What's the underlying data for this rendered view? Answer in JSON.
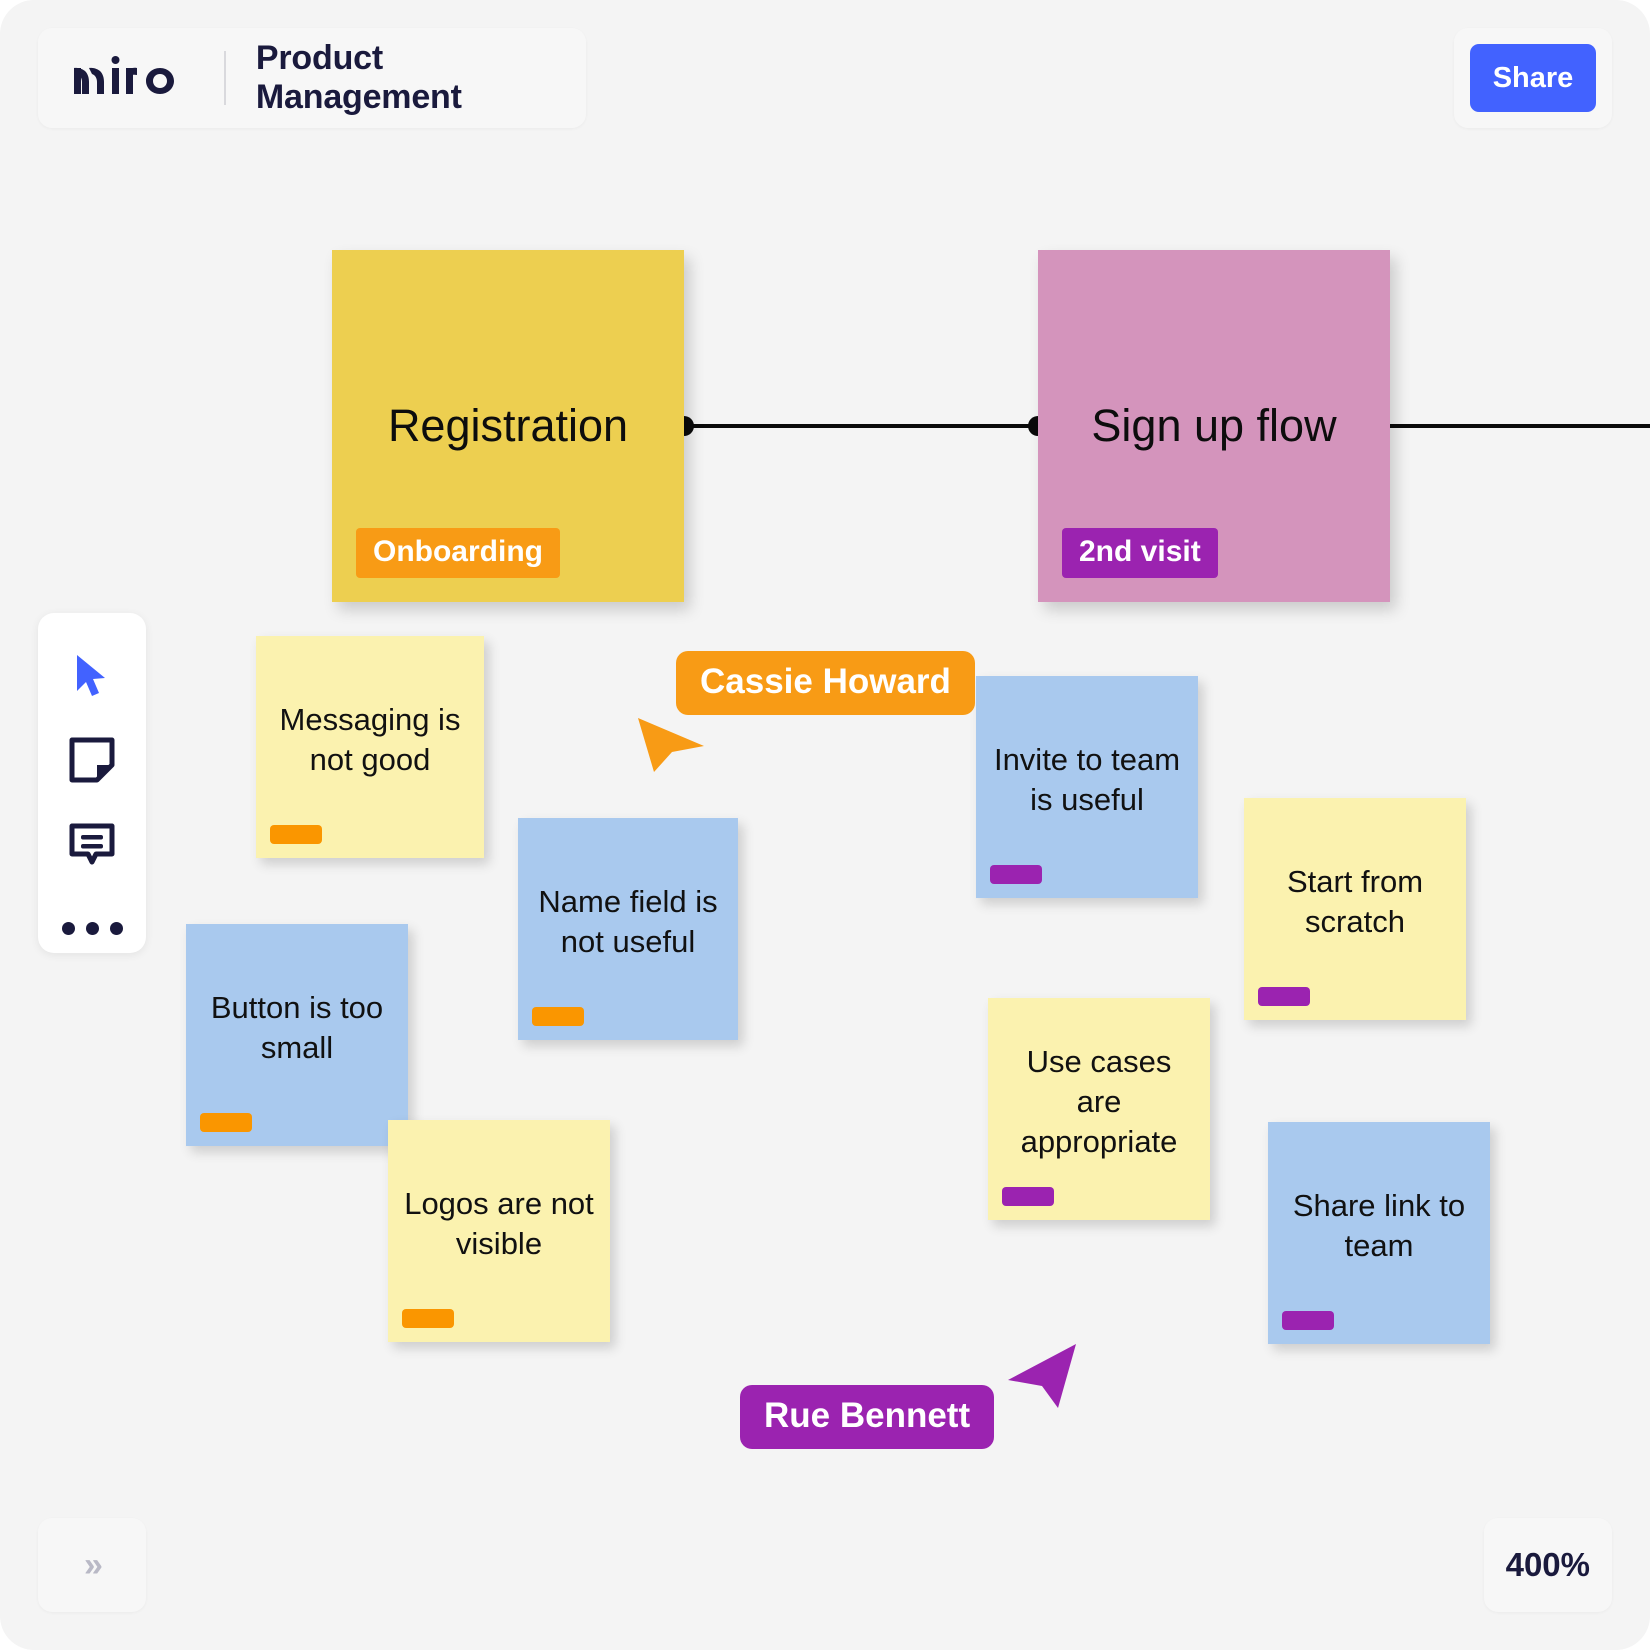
{
  "app": {
    "brand": "miro",
    "board_title": "Product Management"
  },
  "header": {
    "share_label": "Share",
    "share_color": "#4262FF"
  },
  "flow_cards": [
    {
      "title": "Registration",
      "tag": "Onboarding",
      "card_color": "#EDCF50",
      "tag_color": "#F89B15"
    },
    {
      "title": "Sign up flow",
      "tag": "2nd visit",
      "card_color": "#D494BC",
      "tag_color": "#9B23B0"
    }
  ],
  "toolbar": {
    "items": [
      {
        "name": "select-cursor",
        "label": "Select"
      },
      {
        "name": "sticky-note",
        "label": "Sticky note"
      },
      {
        "name": "comment",
        "label": "Comment"
      },
      {
        "name": "more",
        "label": "More tools"
      }
    ]
  },
  "sticky_notes": [
    {
      "text": "Messaging is not good",
      "color": "#FBF2AF",
      "mark": "#FA9600"
    },
    {
      "text": "Name field is not useful",
      "color": "#A9C9EE",
      "mark": "#FA9600"
    },
    {
      "text": "Button is too small",
      "color": "#A9C9EE",
      "mark": "#FA9600"
    },
    {
      "text": "Logos are not visible",
      "color": "#FBF2AF",
      "mark": "#FA9600"
    },
    {
      "text": "Invite to team is useful",
      "color": "#A9C9EE",
      "mark": "#9B23B0"
    },
    {
      "text": "Start from scratch",
      "color": "#FBF2AF",
      "mark": "#9B23B0"
    },
    {
      "text": "Use cases are appropriate",
      "color": "#FBF2AF",
      "mark": "#9B23B0"
    },
    {
      "text": "Share link to team",
      "color": "#A9C9EE",
      "mark": "#9B23B0"
    }
  ],
  "collaborators": [
    {
      "name": "Cassie Howard",
      "color": "#F89B15"
    },
    {
      "name": "Rue Bennett",
      "color": "#9B23B0"
    }
  ],
  "footer": {
    "expand_icon": "chevron-double-right",
    "zoom_level": "400%"
  }
}
